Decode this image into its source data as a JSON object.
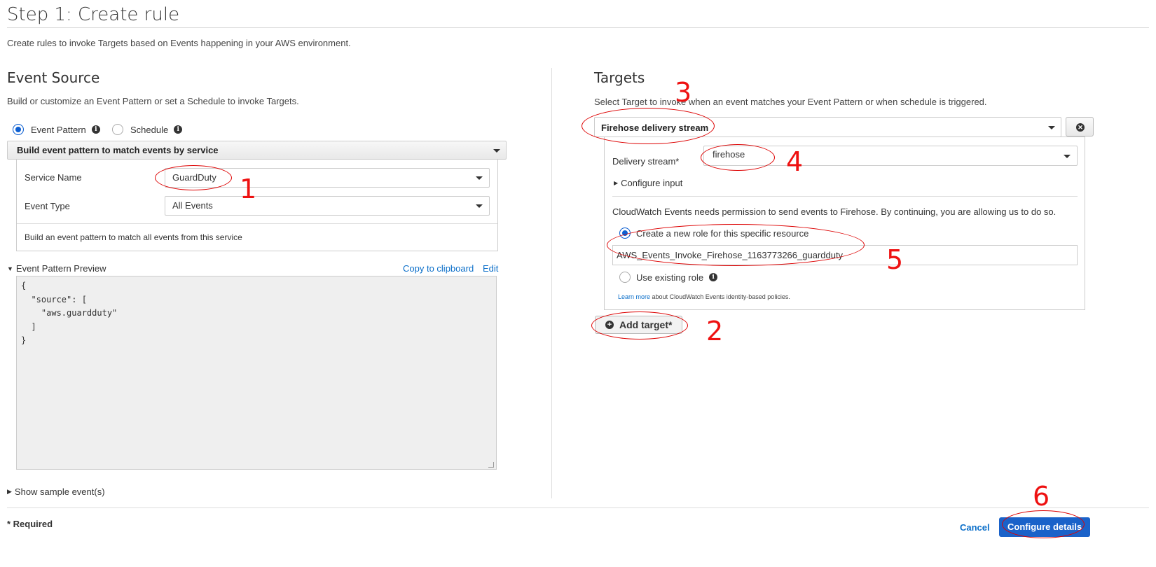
{
  "page": {
    "title": "Step 1: Create rule",
    "description": "Create rules to invoke Targets based on Events happening in your AWS environment."
  },
  "event_source": {
    "heading": "Event Source",
    "description": "Build or customize an Event Pattern or set a Schedule to invoke Targets.",
    "radio_event_pattern": "Event Pattern",
    "radio_schedule": "Schedule",
    "builder_header": "Build event pattern to match events by service",
    "service_name_label": "Service Name",
    "service_name_value": "GuardDuty",
    "event_type_label": "Event Type",
    "event_type_value": "All Events",
    "builder_note": "Build an event pattern to match all events from this service",
    "preview_label": "Event Pattern Preview",
    "copy_link": "Copy to clipboard",
    "edit_link": "Edit",
    "preview_code": "{\n  \"source\": [\n    \"aws.guardduty\"\n  ]\n}",
    "show_sample": "Show sample event(s)"
  },
  "targets": {
    "heading": "Targets",
    "description": "Select Target to invoke when an event matches your Event Pattern or when schedule is triggered.",
    "target_type": "Firehose delivery stream",
    "delivery_stream_label": "Delivery stream*",
    "delivery_stream_value": "firehose",
    "configure_input": "Configure input",
    "permission_note": "CloudWatch Events needs permission to send events to Firehose. By continuing, you are allowing us to do so.",
    "create_role_label": "Create a new role for this specific resource",
    "role_name_value": "AWS_Events_Invoke_Firehose_1163773266_guardduty",
    "use_existing_label": "Use existing role",
    "learn_more_link": "Learn more",
    "learn_more_text": "about CloudWatch Events identity-based policies.",
    "add_target": "Add target*"
  },
  "footer": {
    "required": "* Required",
    "cancel": "Cancel",
    "configure_details": "Configure details"
  },
  "annotations": {
    "n1": "1",
    "n2": "2",
    "n3": "3",
    "n4": "4",
    "n5": "5",
    "n6": "6"
  },
  "colors": {
    "accent": "#0d5fd1",
    "link": "#0a6ec9",
    "annotation": "#e11111",
    "primary_button": "#1a62c9"
  }
}
